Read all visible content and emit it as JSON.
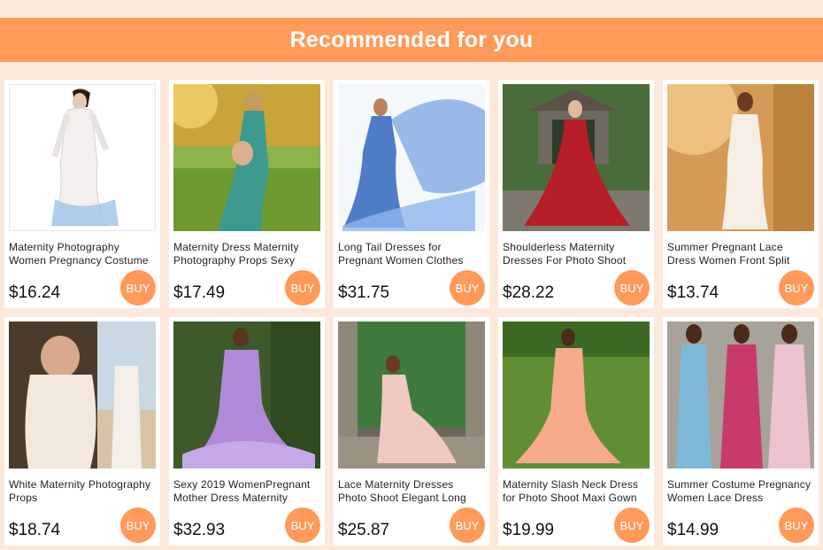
{
  "header": {
    "title": "Recommended for you"
  },
  "buy_label": "BUY",
  "products": [
    {
      "title": "Maternity Photography Women Pregnancy Costume",
      "price": "$16.24",
      "image": "white-lace-gown"
    },
    {
      "title": "Maternity Dress Maternity Photography Props Sexy",
      "price": "$17.49",
      "image": "teal-dress-field"
    },
    {
      "title": "Long Tail Dresses for Pregnant Women Clothes",
      "price": "$31.75",
      "image": "blue-flowing-gown"
    },
    {
      "title": "Shoulderless Maternity Dresses For Photo Shoot",
      "price": "$28.22",
      "image": "red-gown-gazebo"
    },
    {
      "title": "Summer Pregnant Lace Dress Women Front Split",
      "price": "$13.74",
      "image": "white-lace-sunset"
    },
    {
      "title": "White Maternity Photography Props",
      "price": "$18.74",
      "image": "white-lace-flowers"
    },
    {
      "title": "Sexy 2019 WomenPregnant Mother Dress Maternity",
      "price": "$32.93",
      "image": "lilac-mermaid-gown"
    },
    {
      "title": "Lace Maternity Dresses Photo Shoot Elegant Long",
      "price": "$25.87",
      "image": "pink-lace-stone"
    },
    {
      "title": "Maternity Slash Neck Dress for Photo Shoot Maxi Gown",
      "price": "$19.99",
      "image": "peach-gown-lawn"
    },
    {
      "title": "Summer Costume Pregnancy Women Lace Dress",
      "price": "$14.99",
      "image": "three-color-gowns"
    }
  ]
}
